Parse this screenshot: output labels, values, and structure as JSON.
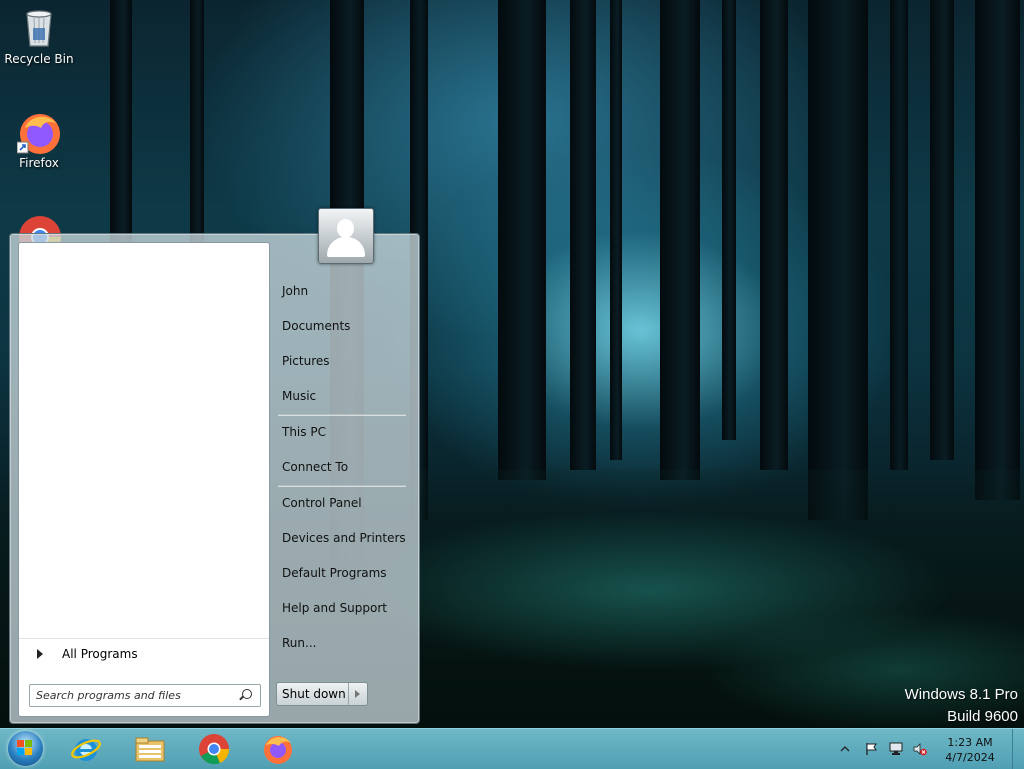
{
  "desktop": {
    "icons": [
      {
        "label": "Recycle Bin",
        "icon": "recycle-bin-icon"
      },
      {
        "label": "Firefox",
        "icon": "firefox-icon"
      },
      {
        "label": "",
        "icon": "chrome-icon"
      }
    ],
    "watermark": {
      "line1": "Windows 8.1 Pro",
      "line2": "Build 9600"
    }
  },
  "start_menu": {
    "all_programs": "All Programs",
    "search_placeholder": "Search programs and files",
    "right_links": [
      "John",
      "Documents",
      "Pictures",
      "Music",
      "This PC",
      "Connect To",
      "Control Panel",
      "Devices and Printers",
      "Default Programs",
      "Help and Support",
      "Run..."
    ],
    "shutdown_label": "Shut down"
  },
  "taskbar": {
    "pinned": [
      "start-orb-icon",
      "internet-explorer-icon",
      "file-explorer-icon",
      "chrome-icon",
      "firefox-icon"
    ],
    "tray_icons": [
      "show-hidden-icons-chevron",
      "action-center-flag-icon",
      "network-icon",
      "volume-muted-icon"
    ],
    "clock": {
      "time": "1:23 AM",
      "date": "4/7/2024"
    }
  },
  "colors": {
    "taskbar": "#5aa9bc",
    "start_menu_glass": "#c3d1d6"
  }
}
